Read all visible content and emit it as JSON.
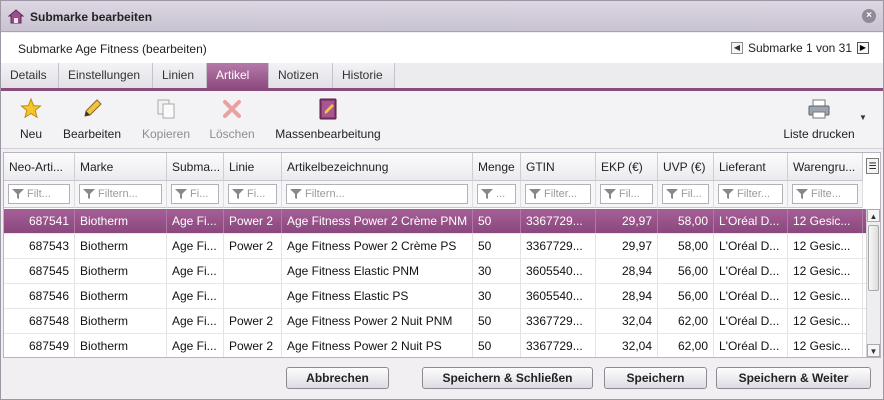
{
  "window": {
    "title": "Submarke bearbeiten",
    "close_label": "×"
  },
  "subheader": {
    "heading": "Submarke Age Fitness (bearbeiten)",
    "pager": "Submarke 1 von 31"
  },
  "tabs": [
    {
      "label": "Details"
    },
    {
      "label": "Einstellungen"
    },
    {
      "label": "Linien"
    },
    {
      "label": "Artikel",
      "active": true
    },
    {
      "label": "Notizen"
    },
    {
      "label": "Historie"
    }
  ],
  "toolbar": {
    "new": {
      "label": "Neu",
      "icon": "star-icon"
    },
    "edit": {
      "label": "Bearbeiten",
      "icon": "pencil-icon"
    },
    "copy": {
      "label": "Kopieren",
      "icon": "copy-icon"
    },
    "delete": {
      "label": "Löschen",
      "icon": "delete-icon"
    },
    "bulk": {
      "label": "Massenbearbeitung",
      "icon": "book-icon"
    },
    "print": {
      "label": "Liste drucken",
      "icon": "printer-icon"
    }
  },
  "table": {
    "columns": [
      "Neo-Arti...",
      "Marke",
      "Subma...",
      "Linie",
      "Artikelbezeichnung",
      "Menge",
      "GTIN",
      "EKP (€)",
      "UVP (€)",
      "Lieferant",
      "Warengru..."
    ],
    "filters": [
      "Filt...",
      "Filtern...",
      "Fi...",
      "Fi...",
      "Filtern...",
      "...",
      "Filter...",
      "Fil...",
      "Fil...",
      "Filter...",
      "Filte..."
    ],
    "rows": [
      [
        "687541",
        "Biotherm",
        "Age Fi...",
        "Power 2",
        "Age Fitness Power 2 Crème PNM",
        "50",
        "3367729...",
        "29,97",
        "58,00",
        "L'Oréal D...",
        "12 Gesic..."
      ],
      [
        "687543",
        "Biotherm",
        "Age Fi...",
        "Power 2",
        "Age Fitness Power 2 Crème PS",
        "50",
        "3367729...",
        "29,97",
        "58,00",
        "L'Oréal D...",
        "12 Gesic..."
      ],
      [
        "687545",
        "Biotherm",
        "Age Fi...",
        "",
        "Age Fitness Elastic PNM",
        "30",
        "3605540...",
        "28,94",
        "56,00",
        "L'Oréal D...",
        "12 Gesic..."
      ],
      [
        "687546",
        "Biotherm",
        "Age Fi...",
        "",
        "Age Fitness Elastic PS",
        "30",
        "3605540...",
        "28,94",
        "56,00",
        "L'Oréal D...",
        "12 Gesic..."
      ],
      [
        "687548",
        "Biotherm",
        "Age Fi...",
        "Power 2",
        "Age Fitness Power 2 Nuit PNM",
        "50",
        "3367729...",
        "32,04",
        "62,00",
        "L'Oréal D...",
        "12 Gesic..."
      ],
      [
        "687549",
        "Biotherm",
        "Age Fi...",
        "Power 2",
        "Age Fitness Power 2 Nuit PS",
        "50",
        "3367729...",
        "32,04",
        "62,00",
        "L'Oréal D...",
        "12 Gesic..."
      ]
    ],
    "selected_row": 0
  },
  "footer": {
    "cancel": "Abbrechen",
    "save_close": "Speichern & Schließen",
    "save": "Speichern",
    "save_next": "Speichern & Weiter"
  },
  "colors": {
    "accent": "#8e4b81",
    "selected_row": "#9a5590"
  }
}
